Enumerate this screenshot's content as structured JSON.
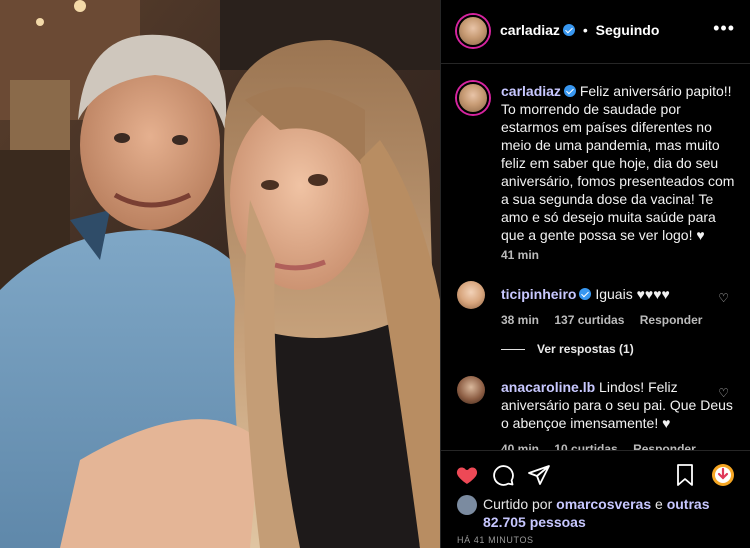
{
  "post": {
    "username": "carladiaz",
    "follow_status": "Seguindo",
    "more_label": "•••"
  },
  "caption": {
    "username": "carladiaz",
    "text": "Feliz aniversário papito!! To morrendo de saudade por estarmos em países diferentes no meio de uma pandemia, mas muito feliz em saber que hoje, dia do seu aniversário, fomos presenteados com a sua segunda dose da vacina! Te amo e só desejo muita saúde para que a gente possa se ver logo! ♥",
    "time": "41 min"
  },
  "comments": [
    {
      "username": "ticipinheiro",
      "text": "Iguais ♥♥♥♥",
      "time": "38 min",
      "likes": "137 curtidas",
      "reply": "Responder",
      "view_replies": "Ver respostas (1)"
    },
    {
      "username": "anacaroline.lb",
      "text": "Lindos! Feliz aniversário para o seu pai. Que Deus o abençoe imensamente! ♥",
      "time": "40 min",
      "likes": "10 curtidas",
      "reply": "Responder"
    }
  ],
  "likes": {
    "prefix": "Curtido por",
    "user": "omarcosveras",
    "connector": "e",
    "others": "outras 82.705 pessoas"
  },
  "timestamp": "HÁ 41 MINUTOS",
  "colors": {
    "heart_red": "#ed4956",
    "verified_blue": "#3897f0",
    "save_badge": "#f5a623"
  }
}
